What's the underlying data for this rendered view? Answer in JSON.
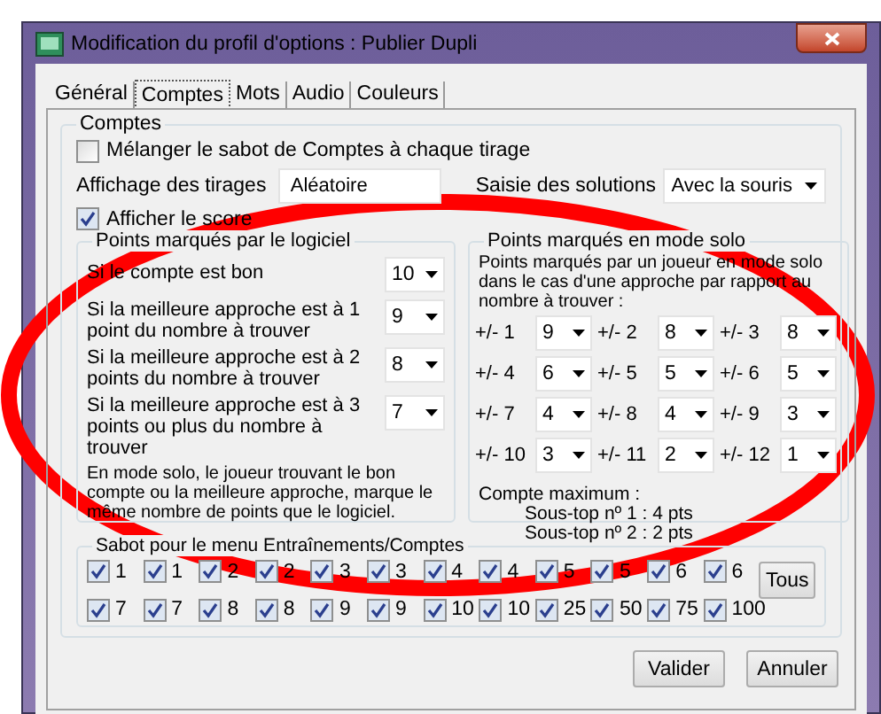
{
  "window": {
    "title": "Modification du profil d'options : Publier Dupli"
  },
  "tabs": [
    {
      "label": "Général",
      "selected": false
    },
    {
      "label": "Comptes",
      "selected": true
    },
    {
      "label": "Mots",
      "selected": false
    },
    {
      "label": "Audio",
      "selected": false
    },
    {
      "label": "Couleurs",
      "selected": false
    }
  ],
  "comptes": {
    "legend": "Comptes",
    "shuffle": {
      "label": "Mélanger le sabot de Comptes à chaque tirage",
      "checked": false
    },
    "display": {
      "label": "Affichage des tirages",
      "value": "Aléatoire"
    },
    "entry": {
      "label": "Saisie des solutions",
      "value": "Avec la souris"
    },
    "show_score": {
      "label": "Afficher le score",
      "checked": true
    }
  },
  "software_points": {
    "legend": "Points marqués par le logiciel",
    "rows": [
      {
        "label": "Si le compte est bon",
        "value": "10"
      },
      {
        "label": "Si la meilleure approche est à 1 point du nombre à trouver",
        "value": "9"
      },
      {
        "label": "Si la meilleure approche est à  2 points du nombre à trouver",
        "value": "8"
      },
      {
        "label": "Si la meilleure approche est à 3 points ou plus du nombre à trouver",
        "value": "7"
      }
    ],
    "note": "En mode solo, le joueur trouvant le bon compte ou la meilleure approche, marque le même nombre de points que le logiciel."
  },
  "solo_points": {
    "legend": "Points marqués en mode solo",
    "description": "Points marqués par un joueur en mode solo dans le cas d'une approche par rapport au nombre à trouver :",
    "approaches": [
      {
        "label": "+/- 1",
        "value": "9"
      },
      {
        "label": "+/- 2",
        "value": "8"
      },
      {
        "label": "+/- 3",
        "value": "8"
      },
      {
        "label": "+/- 4",
        "value": "6"
      },
      {
        "label": "+/- 5",
        "value": "5"
      },
      {
        "label": "+/- 6",
        "value": "5"
      },
      {
        "label": "+/- 7",
        "value": "4"
      },
      {
        "label": "+/- 8",
        "value": "4"
      },
      {
        "label": "+/- 9",
        "value": "3"
      },
      {
        "label": "+/- 10",
        "value": "3"
      },
      {
        "label": "+/- 11",
        "value": "2"
      },
      {
        "label": "+/- 12",
        "value": "1"
      }
    ],
    "max_title": "Compte maximum :",
    "max_lines": [
      "Sous-top nº 1 : 4 pts",
      "Sous-top nº 2 : 2 pts"
    ]
  },
  "sabot": {
    "legend": "Sabot pour le menu Entraînements/Comptes",
    "plates": [
      {
        "label": "1",
        "checked": true
      },
      {
        "label": "1",
        "checked": true
      },
      {
        "label": "2",
        "checked": true
      },
      {
        "label": "2",
        "checked": true
      },
      {
        "label": "3",
        "checked": true
      },
      {
        "label": "3",
        "checked": true
      },
      {
        "label": "4",
        "checked": true
      },
      {
        "label": "4",
        "checked": true
      },
      {
        "label": "5",
        "checked": true
      },
      {
        "label": "5",
        "checked": true
      },
      {
        "label": "6",
        "checked": true
      },
      {
        "label": "6",
        "checked": true
      },
      {
        "label": "7",
        "checked": true
      },
      {
        "label": "7",
        "checked": true
      },
      {
        "label": "8",
        "checked": true
      },
      {
        "label": "8",
        "checked": true
      },
      {
        "label": "9",
        "checked": true
      },
      {
        "label": "9",
        "checked": true
      },
      {
        "label": "10",
        "checked": true
      },
      {
        "label": "10",
        "checked": true
      },
      {
        "label": "25",
        "checked": true
      },
      {
        "label": "50",
        "checked": true
      },
      {
        "label": "75",
        "checked": true
      },
      {
        "label": "100",
        "checked": true
      }
    ],
    "all_button": "Tous"
  },
  "buttons": [
    "Valider",
    "Annuler"
  ]
}
